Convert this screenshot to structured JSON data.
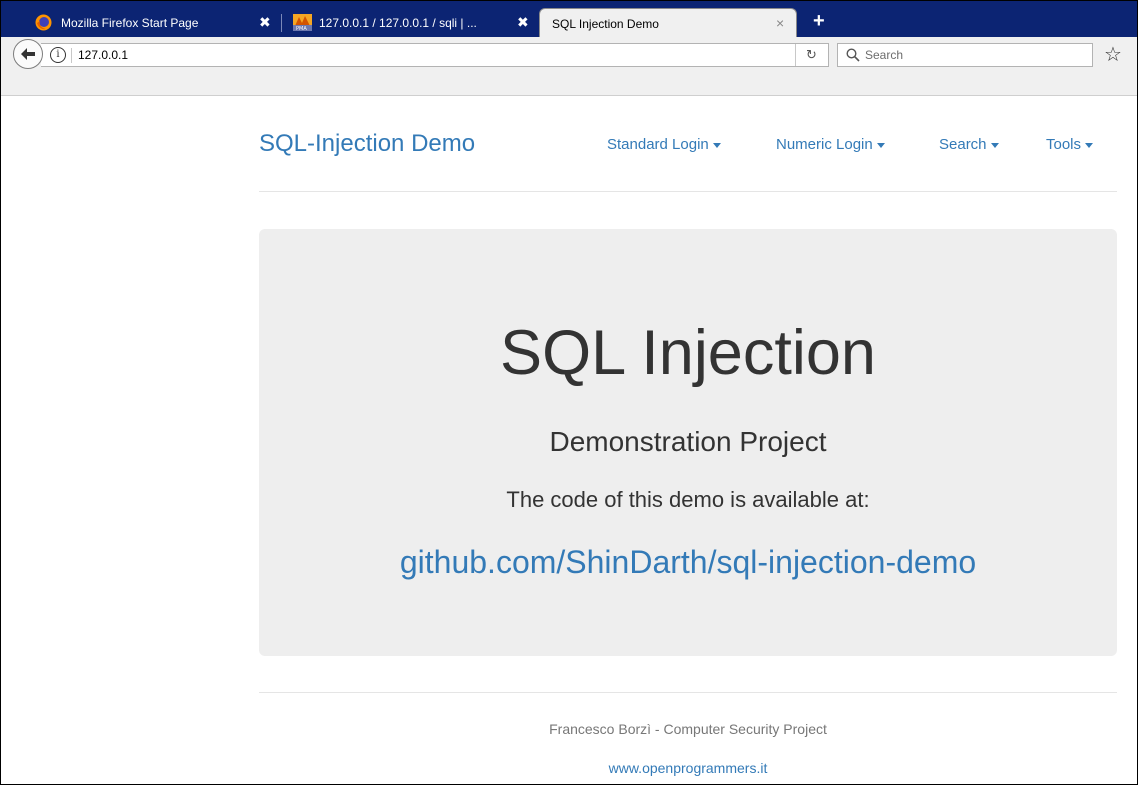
{
  "browser": {
    "tabs": [
      {
        "label": "Mozilla Firefox Start Page",
        "close": "✖"
      },
      {
        "label": "127.0.0.1 / 127.0.0.1 / sqli | ...",
        "close": "✖"
      },
      {
        "label": "SQL Injection Demo",
        "close": "×",
        "active": true
      }
    ],
    "new_tab": "+",
    "url": "127.0.0.1",
    "search_placeholder": "Search",
    "tab_bar_color": "#0c2473"
  },
  "site": {
    "brand": "SQL-Injection Demo",
    "menu": [
      {
        "label": "Standard Login"
      },
      {
        "label": "Numeric Login"
      },
      {
        "label": "Search"
      },
      {
        "label": "Tools"
      }
    ],
    "link_color": "#337ab7"
  },
  "jumbotron": {
    "title": "SQL Injection",
    "subtitle": "Demonstration Project",
    "text": "The code of this demo is available at:",
    "link": "github.com/ShinDarth/sql-injection-demo"
  },
  "footer": {
    "author": "Francesco Borzì - Computer Security Project",
    "link": "www.openprogrammers.it"
  }
}
